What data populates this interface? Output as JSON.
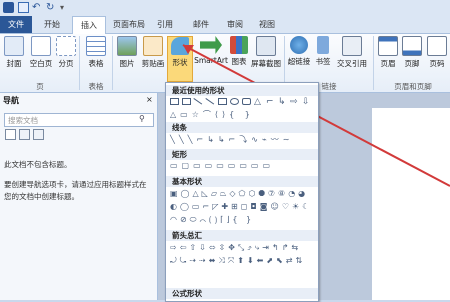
{
  "tabs": [
    "文件",
    "开始",
    "插入",
    "页面布局",
    "引用",
    "邮件",
    "审阅",
    "视图"
  ],
  "ribbon": {
    "buttons": [
      "封面",
      "空白页",
      "分页",
      "表格",
      "图片",
      "剪贴画",
      "形状",
      "SmartArt",
      "图表",
      "屏幕截图",
      "超链接",
      "书签",
      "交叉引用",
      "页眉",
      "页脚",
      "页码"
    ],
    "groups": [
      "页",
      "表格",
      "链接",
      "页眉和页脚"
    ]
  },
  "nav": {
    "title": "导航",
    "search_placeholder": "搜索文档",
    "msg1": "此文档不包含标题。",
    "msg2": "要创建导航选项卡，请通过应用标题样式在您的文档中创建标题。"
  },
  "shapes": {
    "sections": [
      "最近使用的形状",
      "线条",
      "矩形",
      "基本形状",
      "箭头总汇",
      "公式形状"
    ]
  },
  "colors": {
    "accent": "#2b5797",
    "arrow": "#d23a3a"
  }
}
